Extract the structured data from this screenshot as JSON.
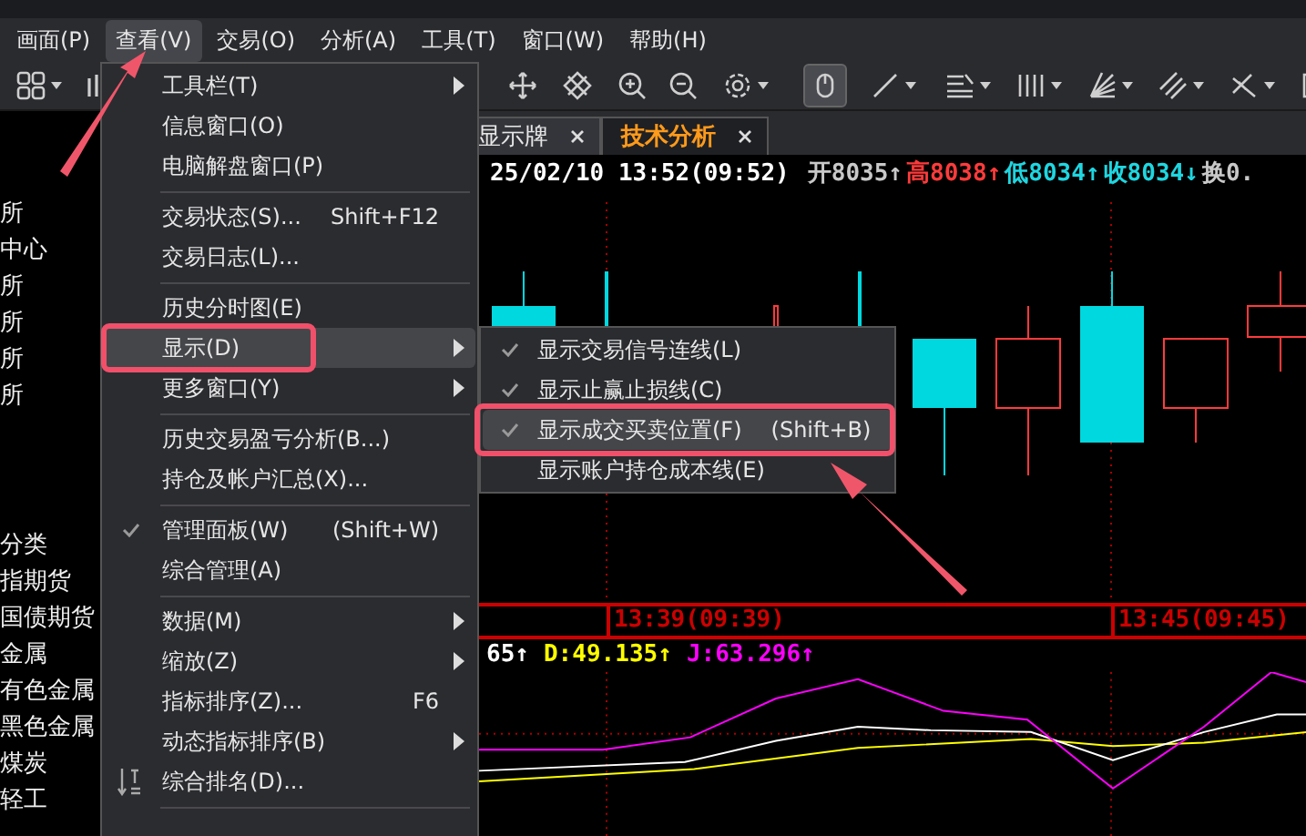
{
  "menubar": [
    {
      "label": "画面(P)",
      "selected": false
    },
    {
      "label": "查看(V)",
      "selected": true
    },
    {
      "label": "交易(O)",
      "selected": false
    },
    {
      "label": "分析(A)",
      "selected": false
    },
    {
      "label": "工具(T)",
      "selected": false
    },
    {
      "label": "窗口(W)",
      "selected": false
    },
    {
      "label": "帮助(H)",
      "selected": false
    }
  ],
  "toolbar": [
    {
      "selected": false,
      "caret": true
    },
    {
      "selected": false,
      "caret": false
    },
    {
      "selected": false,
      "caret": false
    },
    {
      "selected": false,
      "caret": false
    },
    {
      "selected": false,
      "caret": false
    },
    {
      "selected": false,
      "caret": false
    },
    {
      "selected": false,
      "caret": true
    },
    {
      "selected": true,
      "caret": false
    },
    {
      "selected": false,
      "caret": true
    },
    {
      "selected": false,
      "caret": true
    },
    {
      "selected": false,
      "caret": true
    },
    {
      "selected": false,
      "caret": true
    },
    {
      "selected": false,
      "caret": true
    },
    {
      "selected": false,
      "caret": true
    },
    {
      "selected": false,
      "caret": false
    }
  ],
  "sidebar": {
    "exchanges": [
      "所",
      "中心",
      "所",
      "所",
      "所",
      "所"
    ],
    "categories": [
      "分类",
      "指期货",
      "国债期货",
      "金属",
      "有色金属",
      "黑色金属",
      "煤炭",
      "轻工"
    ]
  },
  "tabs": [
    {
      "label": "显示牌",
      "selected": false
    },
    {
      "label": "技术分析",
      "selected": true
    }
  ],
  "quote_line": {
    "datetime": "25/02/10 13:52(09:52)",
    "items": [
      {
        "text": "开8035",
        "arrow": "↑",
        "color": "#c8c8c8"
      },
      {
        "text": "高8038",
        "arrow": "↑",
        "color": "#ff3b3b"
      },
      {
        "text": "低8034",
        "arrow": "↑",
        "color": "#1fd6e0"
      },
      {
        "text": "收8034",
        "arrow": "↓",
        "color": "#1fd6e0"
      },
      {
        "text": "换0.",
        "color": "#c8c8c8"
      }
    ]
  },
  "time_axis": [
    "13:39(09:39)",
    "13:45(09:45)"
  ],
  "indicator_labels": [
    {
      "text": "65",
      "arrow": "↑",
      "color": "#ffffff"
    },
    {
      "text": "D:49.135",
      "arrow": "↑",
      "color": "#ffff00"
    },
    {
      "text": "J:63.296",
      "arrow": "↑",
      "color": "#ff00ff"
    }
  ],
  "view_menu": {
    "items": [
      {
        "kind": "item",
        "label": "工具栏(T)",
        "submenu": true,
        "checked": false,
        "selected": false
      },
      {
        "kind": "item",
        "label": "信息窗口(O)",
        "submenu": false,
        "checked": false,
        "selected": false
      },
      {
        "kind": "item",
        "label": "电脑解盘窗口(P)",
        "submenu": false,
        "checked": false,
        "selected": false
      },
      {
        "kind": "separator"
      },
      {
        "kind": "item",
        "label": "交易状态(S)...",
        "shortcut": "Shift+F12",
        "submenu": false,
        "checked": false,
        "selected": false
      },
      {
        "kind": "item",
        "label": "交易日志(L)...",
        "submenu": false,
        "checked": false,
        "selected": false
      },
      {
        "kind": "separator"
      },
      {
        "kind": "item",
        "label": "历史分时图(E)",
        "submenu": false,
        "checked": false,
        "selected": false
      },
      {
        "kind": "item",
        "label": "显示(D)",
        "submenu": true,
        "checked": false,
        "selected": true
      },
      {
        "kind": "item",
        "label": "更多窗口(Y)",
        "submenu": true,
        "checked": false,
        "selected": false
      },
      {
        "kind": "separator"
      },
      {
        "kind": "item",
        "label": "历史交易盈亏分析(B...)",
        "submenu": false,
        "checked": false,
        "selected": false
      },
      {
        "kind": "item",
        "label": "持仓及帐户汇总(X)...",
        "submenu": false,
        "checked": false,
        "selected": false
      },
      {
        "kind": "separator"
      },
      {
        "kind": "item",
        "label": "管理面板(W)",
        "shortcut": "(Shift+W)",
        "submenu": false,
        "checked": true,
        "selected": false
      },
      {
        "kind": "item",
        "label": "综合管理(A)",
        "submenu": false,
        "checked": false,
        "selected": false
      },
      {
        "kind": "separator"
      },
      {
        "kind": "item",
        "label": "数据(M)",
        "submenu": true,
        "checked": false,
        "selected": false
      },
      {
        "kind": "item",
        "label": "缩放(Z)",
        "submenu": true,
        "checked": false,
        "selected": false
      },
      {
        "kind": "item",
        "label": "指标排序(Z)...",
        "shortcut": "F6",
        "submenu": false,
        "checked": false,
        "selected": false
      },
      {
        "kind": "item",
        "label": "动态指标排序(B)",
        "submenu": true,
        "checked": false,
        "selected": false
      },
      {
        "kind": "item_with_icon",
        "label": "综合排名(D)...",
        "submenu": false,
        "checked": false,
        "selected": false
      },
      {
        "kind": "separator"
      }
    ]
  },
  "display_submenu": {
    "items": [
      {
        "label": "显示交易信号连线(L)",
        "checked": true,
        "selected": false
      },
      {
        "label": "显示止赢止损线(C)",
        "checked": true,
        "selected": false
      },
      {
        "label": "显示成交买卖位置(F)",
        "shortcut": "(Shift+B)",
        "checked": true,
        "selected": true
      },
      {
        "label": "显示账户持仓成本线(E)",
        "checked": false,
        "selected": false
      }
    ]
  }
}
